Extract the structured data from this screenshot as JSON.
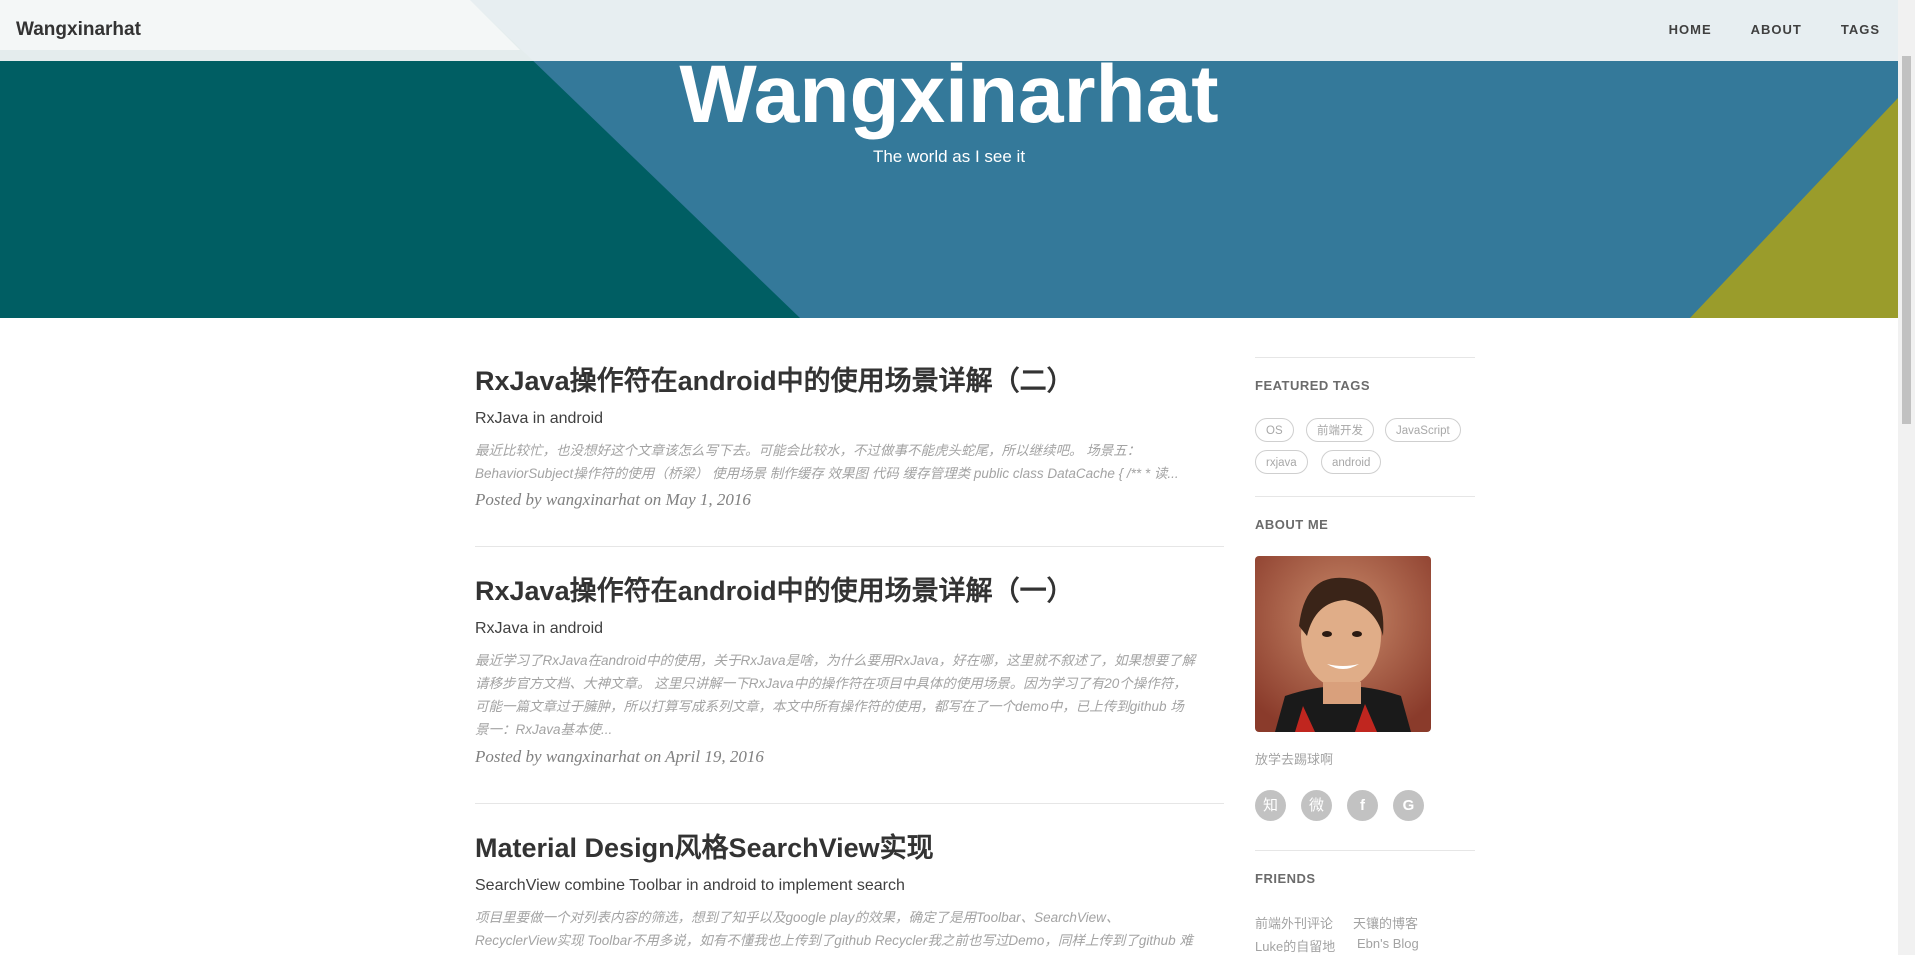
{
  "navbar": {
    "brand": "Wangxinarhat",
    "links": [
      "HOME",
      "ABOUT",
      "TAGS"
    ]
  },
  "header": {
    "title": "Wangxinarhat",
    "subtitle": "The world as I see it"
  },
  "posts": [
    {
      "title": "RxJava操作符在android中的使用场景详解（二）",
      "subtitle": "RxJava in android",
      "excerpt_lines": [
        "最近比较忙，也没想好这个文章该怎么写下去。可能会比较水，不过做事不能虎头蛇尾，所以继续吧。 场景五：",
        "BehaviorSubject操作符的使用（桥梁） 使用场景 制作缓存 效果图 代码 缓存管理类 public class DataCache { /** * 读..."
      ],
      "meta_prefix": "Posted by wangxinarhat on May 1, 2016"
    },
    {
      "title": "RxJava操作符在android中的使用场景详解（一）",
      "subtitle": "RxJava in android",
      "excerpt_lines": [
        "最近学习了RxJava在android中的使用，关于RxJava是啥，为什么要用RxJava，好在哪，这里就不叙述了，如果想要了解",
        "请移步官方文档、大神文章。 这里只讲解一下RxJava中的操作符在项目中具体的使用场景。因为学习了有20个操作符，",
        "可能一篇文章过于臃肿，所以打算写成系列文章，本文中所有操作符的使用，都写在了一个demo中，已上传到github 场",
        "景一：RxJava基本使..."
      ],
      "meta_prefix": "Posted by wangxinarhat on April 19, 2016"
    },
    {
      "title": "Material Design风格SearchView实现",
      "subtitle": "SearchView combine Toolbar in android to implement search",
      "excerpt_lines": [
        "项目里要做一个对列表内容的筛选，想到了知乎以及google play的效果，确定了是用Toolbar、SearchView、",
        "RecyclerView实现 Toolbar不用多说，如有不懂我也上传到了github Recycler我之前也写过Demo，同样上传到了github 难"
      ],
      "meta_prefix": ""
    }
  ],
  "sidebar": {
    "featured_tags_heading": "FEATURED TAGS",
    "tags": [
      "OS",
      "前端开发",
      "JavaScript",
      "rxjava",
      "android"
    ],
    "about_heading": "ABOUT ME",
    "about_text": "放学去踢球啊",
    "social_icons": [
      "zhihu-icon",
      "weibo-icon",
      "facebook-icon",
      "github-icon"
    ],
    "social_glyphs": [
      "知",
      "微",
      "f",
      "G"
    ],
    "friends_heading": "FRIENDS",
    "friends": [
      "前端外刊评论",
      "天镶的博客",
      "Luke的自留地",
      "Ebn's Blog"
    ]
  },
  "colors": {
    "banner_main": "#34799a",
    "banner_dark": "#005e63",
    "banner_accent": "#9a9c2b"
  }
}
